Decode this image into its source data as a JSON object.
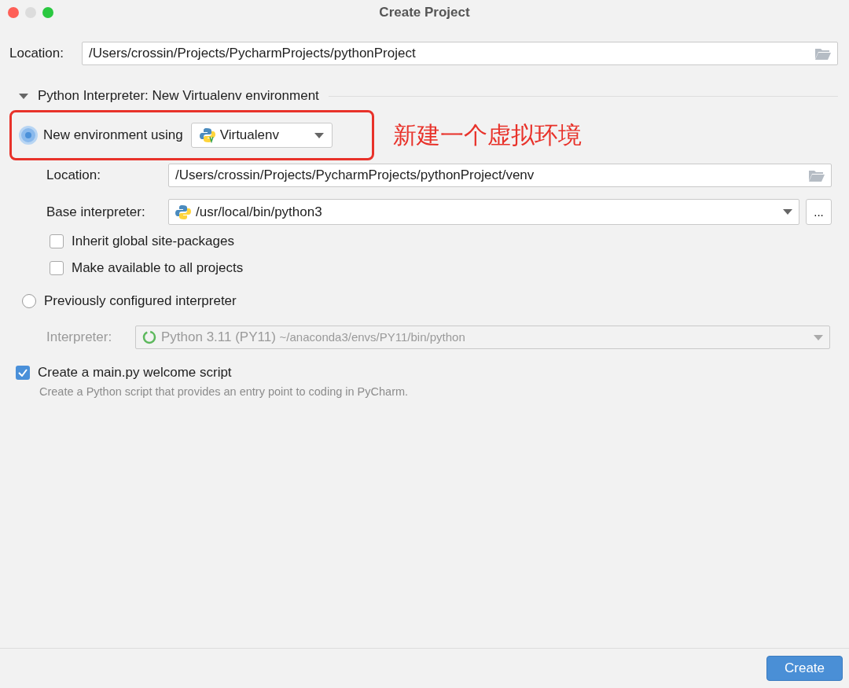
{
  "window": {
    "title": "Create Project"
  },
  "location": {
    "label": "Location:",
    "value": "/Users/crossin/Projects/PycharmProjects/pythonProject"
  },
  "interpreter_section": {
    "title": "Python Interpreter: New Virtualenv environment",
    "expanded": true
  },
  "new_environment": {
    "label": "New environment using",
    "selected": true,
    "tool": "Virtualenv",
    "location": {
      "label": "Location:",
      "value": "/Users/crossin/Projects/PycharmProjects/pythonProject/venv"
    },
    "base_interpreter": {
      "label": "Base interpreter:",
      "value": "/usr/local/bin/python3",
      "browse": "..."
    },
    "options": [
      {
        "label": "Inherit global site-packages",
        "checked": false
      },
      {
        "label": "Make available to all projects",
        "checked": false
      }
    ]
  },
  "annotation": {
    "text": "新建一个虚拟环境"
  },
  "previous": {
    "label": "Previously configured interpreter",
    "selected": false,
    "interpreter": {
      "label": "Interpreter:",
      "value": "Python 3.11 (PY11)",
      "path": "~/anaconda3/envs/PY11/bin/python",
      "disabled": true
    }
  },
  "welcome_script": {
    "label": "Create a main.py welcome script",
    "checked": true,
    "description": "Create a Python script that provides an entry point to coding in PyCharm."
  },
  "buttons": [
    {
      "label": "Create"
    }
  ]
}
